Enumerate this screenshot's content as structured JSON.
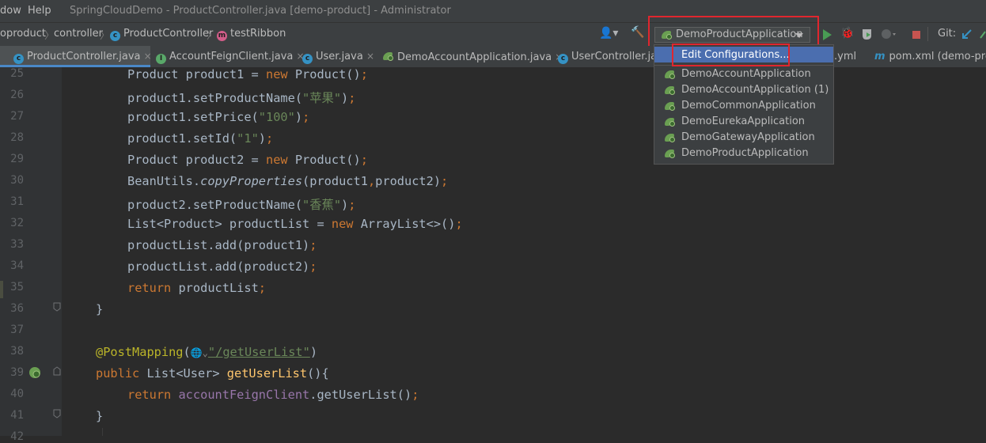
{
  "menu": {
    "window_partial": "dow",
    "help": "Help",
    "title": "SpringCloudDemo - ProductController.java [demo-product] - Administrator"
  },
  "breadcrumb": {
    "c0": "oproduct",
    "c1": "controller",
    "c2": "ProductController",
    "c3": "testRibbon"
  },
  "run_config": {
    "selected": "DemoProductApplication"
  },
  "toolbar": {
    "git_label": "Git:"
  },
  "tabs": [
    {
      "label": "ProductController.java",
      "close": "×"
    },
    {
      "label": "AccountFeignClient.java",
      "close": "×"
    },
    {
      "label": "User.java",
      "close": "×"
    },
    {
      "label": "DemoAccountApplication.java",
      "close": "×"
    },
    {
      "label": "UserController.jav"
    },
    {
      "label": ".yml",
      "close": "×"
    },
    {
      "label": "pom.xml (demo-prod"
    }
  ],
  "dropdown": {
    "edit": "Edit Configurations...",
    "items": [
      "DemoAccountApplication",
      "DemoAccountApplication (1)",
      "DemoCommonApplication",
      "DemoEurekaApplication",
      "DemoGatewayApplication",
      "DemoProductApplication"
    ]
  },
  "line_numbers": [
    "25",
    "26",
    "27",
    "28",
    "29",
    "30",
    "31",
    "32",
    "33",
    "34",
    "35",
    "36",
    "37",
    "38",
    "39",
    "40",
    "41",
    "42"
  ],
  "code": {
    "l25": {
      "a": "Product product1 = ",
      "kw": "new",
      "b": " Product()",
      "semi": ";"
    },
    "l26": {
      "a": "product1.setProductName(",
      "s": "\"苹果\"",
      "b": ")",
      "semi": ";"
    },
    "l27": {
      "a": "product1.setPrice(",
      "s": "\"100\"",
      "b": ")",
      "semi": ";"
    },
    "l28": {
      "a": "product1.setId(",
      "s": "\"1\"",
      "b": ")",
      "semi": ";"
    },
    "l29": {
      "a": "Product product2 = ",
      "kw": "new",
      "b": " Product()",
      "semi": ";"
    },
    "l30": {
      "a": "BeanUtils.",
      "it": "copyProperties",
      "b": "(product1",
      "comma": ",",
      "c": "product2)",
      "semi": ";"
    },
    "l31": {
      "a": "product2.setProductName(",
      "s": "\"香蕉\"",
      "b": ")",
      "semi": ";"
    },
    "l32": {
      "a": "List<Product> productList = ",
      "kw": "new",
      "b": " ArrayList<>()",
      "semi": ";"
    },
    "l33": {
      "a": "productList.add(product1)",
      "semi": ";"
    },
    "l34": {
      "a": "productList.add(product2)",
      "semi": ";"
    },
    "l35": {
      "kw": "return",
      "a": " productList",
      "semi": ";"
    },
    "l36": {
      "a": "}"
    },
    "l38": {
      "ann": "@PostMapping",
      "a": "(",
      "globe": "🌐⌄",
      "url": "\"/getUserList\"",
      "b": ")"
    },
    "l39": {
      "kw": "public",
      "a": " List<User> ",
      "fn": "getUserList",
      "b": "(){"
    },
    "l40": {
      "kw": "return",
      "fld": " accountFeignClient",
      "a": ".getUserList()",
      "semi": ";"
    },
    "l41": {
      "a": "}"
    }
  }
}
